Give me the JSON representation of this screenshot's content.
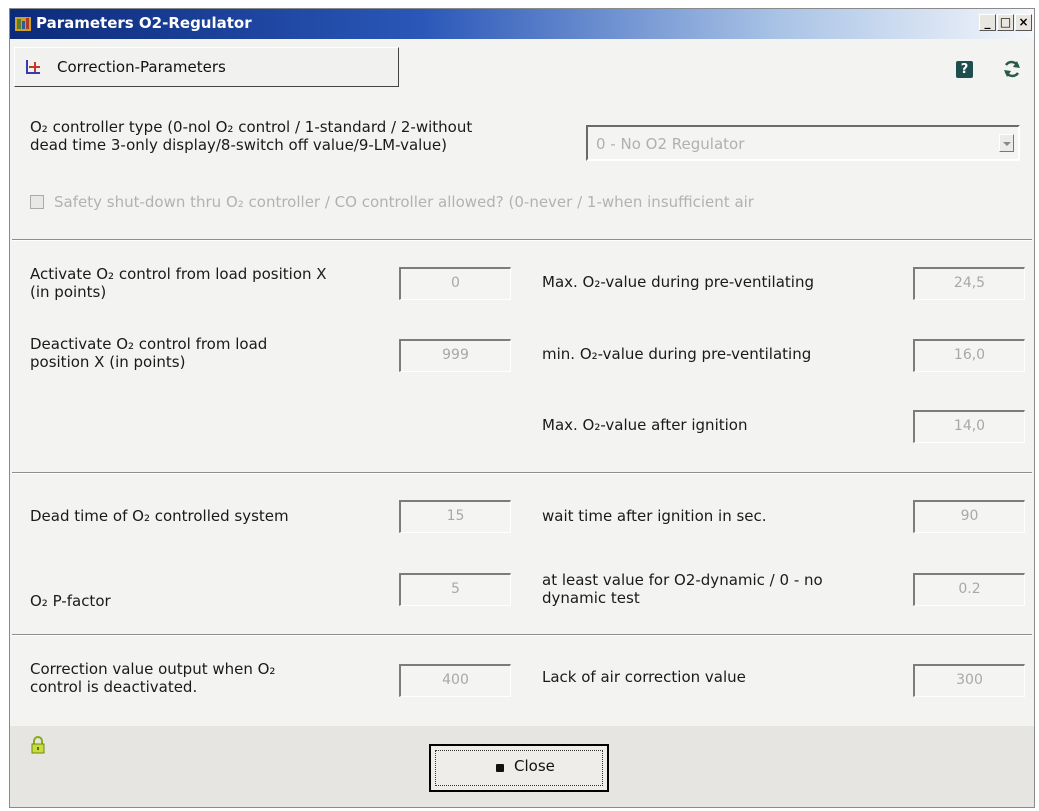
{
  "window": {
    "title": "Parameters O2-Regulator"
  },
  "titlebar_buttons": {
    "minimize": "_",
    "maximize": "□",
    "close": "×"
  },
  "toolbar": {
    "tab_label": "Correction-Parameters",
    "help_glyph": "?"
  },
  "controller_type": {
    "label_line1": "O₂ controller type (0-nol O₂ control / 1-standard / 2-without",
    "label_line2": "dead time 3-only display/8-switch off value/9-LM-value)",
    "selected": "0 - No O2 Regulator"
  },
  "safety": {
    "label": "Safety shut-down thru O₂ controller / CO controller allowed? (0-never / 1-when insufficient air",
    "checked": false
  },
  "section1": {
    "activate": {
      "line1": "Activate O₂ control from load position X",
      "line2": "(in points)",
      "value": "0"
    },
    "deactivate": {
      "line1": "Deactivate O₂ control from load",
      "line2": "position X (in points)",
      "value": "999"
    },
    "max_pre": {
      "label": "Max. O₂-value during pre-ventilating",
      "value": "24,5"
    },
    "min_pre": {
      "label": "min. O₂-value during pre-ventilating",
      "value": "16,0"
    },
    "max_after": {
      "label": "Max. O₂-value after ignition",
      "value": "14,0"
    }
  },
  "section2": {
    "dead_time": {
      "label": "Dead time of O₂ controlled system",
      "value": "15"
    },
    "p_factor": {
      "label": "O₂ P-factor",
      "value": "5"
    },
    "wait_time": {
      "label": "wait time after ignition in sec.",
      "value": "90"
    },
    "dynamic": {
      "line1": "at least value for O2-dynamic / 0 - no",
      "line2": "dynamic test",
      "value": "0.2"
    }
  },
  "section3": {
    "correction_output": {
      "line1": "Correction value output when O₂",
      "line2": "control is deactivated.",
      "value": "400"
    },
    "lack_of_air": {
      "label": "Lack of air correction value",
      "value": "300"
    }
  },
  "footer": {
    "close_label": "Close"
  },
  "colors": {
    "title_start": "#0c2a7a",
    "title_end": "#f4f7fb",
    "window_bg": "#f3f3f2",
    "disabled_text": "#b0b0b0",
    "help_bg": "#1f4e4e",
    "lock": "#9cbd22"
  }
}
